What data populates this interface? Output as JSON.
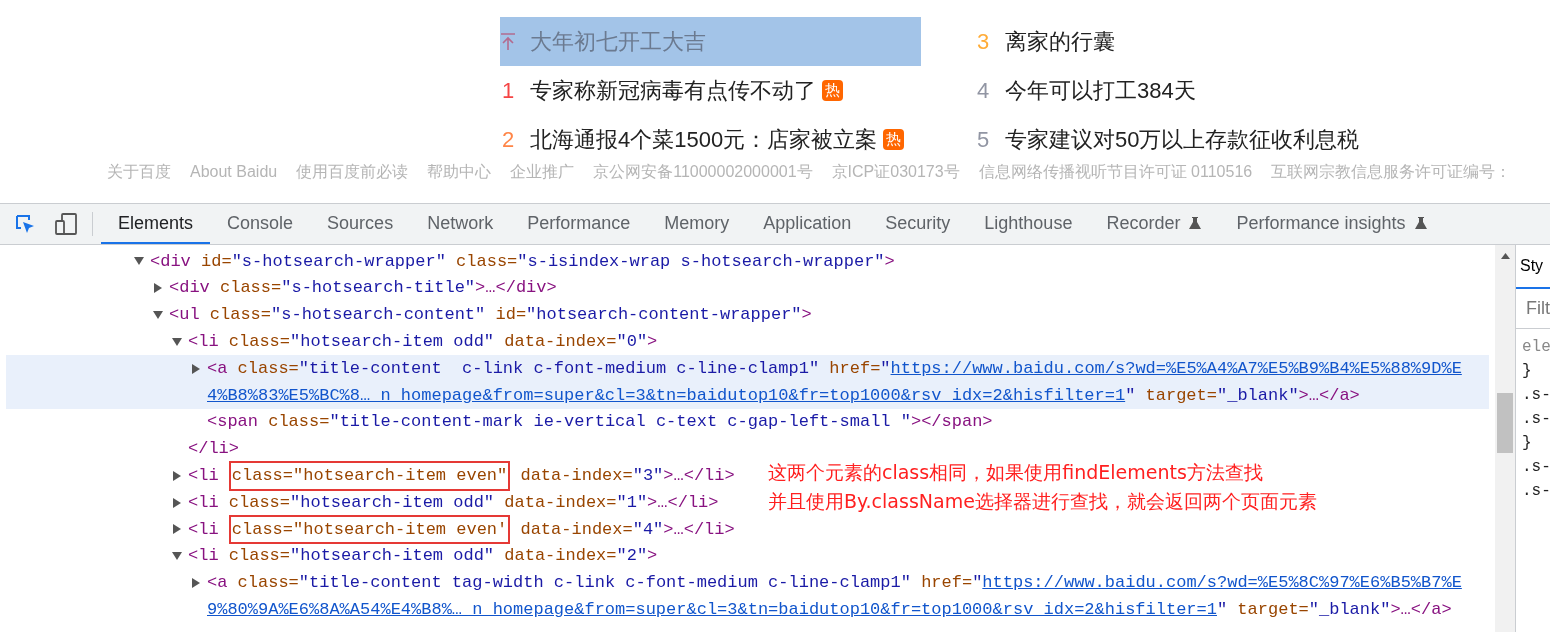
{
  "hot_search": {
    "items": [
      {
        "kind": "pinned",
        "title": "大年初七开工大吉",
        "selected": true,
        "hot": false
      },
      {
        "kind": "ranked",
        "rank": "3",
        "color": "#ffac38",
        "title": "离家的行囊",
        "selected": false,
        "hot": false
      },
      {
        "kind": "ranked",
        "rank": "1",
        "color": "#f54545",
        "title": "专家称新冠病毒有点传不动了",
        "selected": false,
        "hot": true,
        "badge": "热"
      },
      {
        "kind": "ranked",
        "rank": "4",
        "color": "#9195a3",
        "title": "今年可以打工384天",
        "selected": false,
        "hot": false
      },
      {
        "kind": "ranked",
        "rank": "2",
        "color": "#ff8547",
        "title": "北海通报4个菜1500元：店家被立案",
        "selected": false,
        "hot": true,
        "badge": "热"
      },
      {
        "kind": "ranked",
        "rank": "5",
        "color": "#9195a3",
        "title": "专家建议对50万以上存款征收利息税",
        "selected": false,
        "hot": false
      }
    ]
  },
  "footer_links": [
    "关于百度",
    "About Baidu",
    "使用百度前必读",
    "帮助中心",
    "企业推广",
    "京公网安备11000002000001号",
    "京ICP证030173号",
    "信息网络传播视听节目许可证 0110516",
    "互联网宗教信息服务许可证编号："
  ],
  "devtools": {
    "tabs": [
      {
        "label": "Elements",
        "selected": true,
        "experimental": false
      },
      {
        "label": "Console",
        "selected": false,
        "experimental": false
      },
      {
        "label": "Sources",
        "selected": false,
        "experimental": false
      },
      {
        "label": "Network",
        "selected": false,
        "experimental": false
      },
      {
        "label": "Performance",
        "selected": false,
        "experimental": false
      },
      {
        "label": "Memory",
        "selected": false,
        "experimental": false
      },
      {
        "label": "Application",
        "selected": false,
        "experimental": false
      },
      {
        "label": "Security",
        "selected": false,
        "experimental": false
      },
      {
        "label": "Lighthouse",
        "selected": false,
        "experimental": false
      },
      {
        "label": "Recorder",
        "selected": false,
        "experimental": true
      },
      {
        "label": "Performance insights",
        "selected": false,
        "experimental": true
      }
    ],
    "tree": [
      {
        "kind": "expandable",
        "expanded": true,
        "selected": false,
        "rows": [
          {
            "tokens": [
              {
                "kind": "tag",
                "text": "<div "
              },
              {
                "kind": "attr",
                "text": "id="
              },
              {
                "kind": "value",
                "text": "\"s-hotsearch-wrapper\""
              },
              {
                "kind": "attr",
                "text": " class="
              },
              {
                "kind": "value",
                "text": "\"s-isindex-wrap s-hotsearch-wrapper\""
              },
              {
                "kind": "tag",
                "text": ">"
              }
            ]
          }
        ],
        "children": [
          {
            "kind": "expandable",
            "expanded": false,
            "selected": false,
            "rows": [
              {
                "tokens": [
                  {
                    "kind": "tag",
                    "text": "<div "
                  },
                  {
                    "kind": "attr",
                    "text": "class="
                  },
                  {
                    "kind": "value",
                    "text": "\"s-hotsearch-title\""
                  },
                  {
                    "kind": "tag",
                    "text": ">…</div>"
                  }
                ]
              }
            ]
          },
          {
            "kind": "expandable",
            "expanded": true,
            "selected": false,
            "rows": [
              {
                "tokens": [
                  {
                    "kind": "tag",
                    "text": "<ul "
                  },
                  {
                    "kind": "attr",
                    "text": "class="
                  },
                  {
                    "kind": "value",
                    "text": "\"s-hotsearch-content\""
                  },
                  {
                    "kind": "attr",
                    "text": " id="
                  },
                  {
                    "kind": "value",
                    "text": "\"hotsearch-content-wrapper\""
                  },
                  {
                    "kind": "tag",
                    "text": ">"
                  }
                ]
              }
            ],
            "children": [
              {
                "kind": "expandable",
                "expanded": true,
                "selected": false,
                "rows": [
                  {
                    "tokens": [
                      {
                        "kind": "tag",
                        "text": "<li "
                      },
                      {
                        "kind": "attr",
                        "text": "class="
                      },
                      {
                        "kind": "value",
                        "text": "\"hotsearch-item odd\""
                      },
                      {
                        "kind": "attr",
                        "text": " data-index="
                      },
                      {
                        "kind": "value",
                        "text": "\"0\""
                      },
                      {
                        "kind": "tag",
                        "text": ">"
                      }
                    ]
                  }
                ],
                "children": [
                  {
                    "kind": "expandable",
                    "expanded": false,
                    "selected": true,
                    "rows": [
                      {
                        "tokens": [
                          {
                            "kind": "tag",
                            "text": "<a "
                          },
                          {
                            "kind": "attr",
                            "text": "class="
                          },
                          {
                            "kind": "value",
                            "text": "\"title-content  c-link c-font-medium c-line-clamp1\""
                          },
                          {
                            "kind": "attr",
                            "text": " href="
                          },
                          {
                            "kind": "value",
                            "text": "\""
                          },
                          {
                            "kind": "link",
                            "text": "https://www.baidu.com/s?wd=%E5%A4%A7%E5%B9%B4%E5%88%9D%E"
                          }
                        ]
                      },
                      {
                        "tokens": [
                          {
                            "kind": "link",
                            "text": "4%B8%83%E5%BC%8…_n_homepage&from=super&cl=3&tn=baidutop10&fr=top1000&rsv_idx=2&hisfilter=1"
                          },
                          {
                            "kind": "value",
                            "text": "\""
                          },
                          {
                            "kind": "attr",
                            "text": " target="
                          },
                          {
                            "kind": "value",
                            "text": "\"_blank\""
                          },
                          {
                            "kind": "tag",
                            "text": ">…</a>"
                          }
                        ]
                      }
                    ]
                  },
                  {
                    "kind": "leaf",
                    "selected": false,
                    "rows": [
                      {
                        "tokens": [
                          {
                            "kind": "tag",
                            "text": "<span "
                          },
                          {
                            "kind": "attr",
                            "text": "class="
                          },
                          {
                            "kind": "value",
                            "text": "\"title-content-mark ie-vertical c-text c-gap-left-small \""
                          },
                          {
                            "kind": "tag",
                            "text": "></span>"
                          }
                        ]
                      }
                    ]
                  }
                ],
                "close": [
                  {
                    "kind": "tag",
                    "text": "</li>"
                  }
                ]
              },
              {
                "kind": "expandable",
                "expanded": false,
                "selected": false,
                "rows": [
                  {
                    "tokens": [
                      {
                        "kind": "tag",
                        "text": "<li "
                      },
                      {
                        "kind": "boxed",
                        "text": "class=\"hotsearch-item even\""
                      },
                      {
                        "kind": "attr",
                        "text": " data-index="
                      },
                      {
                        "kind": "value",
                        "text": "\"3\""
                      },
                      {
                        "kind": "tag",
                        "text": ">…</li>"
                      }
                    ]
                  }
                ]
              },
              {
                "kind": "expandable",
                "expanded": false,
                "selected": false,
                "rows": [
                  {
                    "tokens": [
                      {
                        "kind": "tag",
                        "text": "<li "
                      },
                      {
                        "kind": "attr",
                        "text": "class="
                      },
                      {
                        "kind": "value",
                        "text": "\"hotsearch-item odd\""
                      },
                      {
                        "kind": "attr",
                        "text": " data-index="
                      },
                      {
                        "kind": "value",
                        "text": "\"1\""
                      },
                      {
                        "kind": "tag",
                        "text": ">…</li>"
                      }
                    ]
                  }
                ]
              },
              {
                "kind": "expandable",
                "expanded": false,
                "selected": false,
                "rows": [
                  {
                    "tokens": [
                      {
                        "kind": "tag",
                        "text": "<li "
                      },
                      {
                        "kind": "boxed",
                        "text": "class=\"hotsearch-item even'"
                      },
                      {
                        "kind": "attr",
                        "text": " data-index="
                      },
                      {
                        "kind": "value",
                        "text": "\"4\""
                      },
                      {
                        "kind": "tag",
                        "text": ">…</li>"
                      }
                    ]
                  }
                ]
              },
              {
                "kind": "expandable",
                "expanded": true,
                "selected": false,
                "rows": [
                  {
                    "tokens": [
                      {
                        "kind": "tag",
                        "text": "<li "
                      },
                      {
                        "kind": "attr",
                        "text": "class="
                      },
                      {
                        "kind": "value",
                        "text": "\"hotsearch-item odd\""
                      },
                      {
                        "kind": "attr",
                        "text": " data-index="
                      },
                      {
                        "kind": "value",
                        "text": "\"2\""
                      },
                      {
                        "kind": "tag",
                        "text": ">"
                      }
                    ]
                  }
                ],
                "children": [
                  {
                    "kind": "expandable",
                    "expanded": false,
                    "selected": false,
                    "rows": [
                      {
                        "tokens": [
                          {
                            "kind": "tag",
                            "text": "<a "
                          },
                          {
                            "kind": "attr",
                            "text": "class="
                          },
                          {
                            "kind": "value",
                            "text": "\"title-content tag-width c-link c-font-medium c-line-clamp1\""
                          },
                          {
                            "kind": "attr",
                            "text": " href="
                          },
                          {
                            "kind": "value",
                            "text": "\""
                          },
                          {
                            "kind": "link",
                            "text": "https://www.baidu.com/s?wd=%E5%8C%97%E6%B5%B7%E"
                          }
                        ]
                      },
                      {
                        "tokens": [
                          {
                            "kind": "link",
                            "text": "9%80%9A%E6%8A%A54%E4%B8%…_n_homepage&from=super&cl=3&tn=baidutop10&fr=top1000&rsv_idx=2&hisfilter=1"
                          },
                          {
                            "kind": "value",
                            "text": "\""
                          },
                          {
                            "kind": "attr",
                            "text": " target="
                          },
                          {
                            "kind": "value",
                            "text": "\"_blank\""
                          },
                          {
                            "kind": "tag",
                            "text": ">…</a>"
                          }
                        ]
                      }
                    ]
                  }
                ]
              }
            ]
          }
        ]
      }
    ],
    "annotation": [
      "这两个元素的class相同，如果使用findElements方法查找",
      "并且使用By.className选择器进行查找，就会返回两个页面元素"
    ],
    "styles_pane": {
      "tab": "Sty",
      "filter_placeholder": "Filt",
      "rules": [
        "ele",
        "}",
        ".s-",
        ".s-",
        "}",
        ".s-",
        ".s-"
      ]
    }
  }
}
